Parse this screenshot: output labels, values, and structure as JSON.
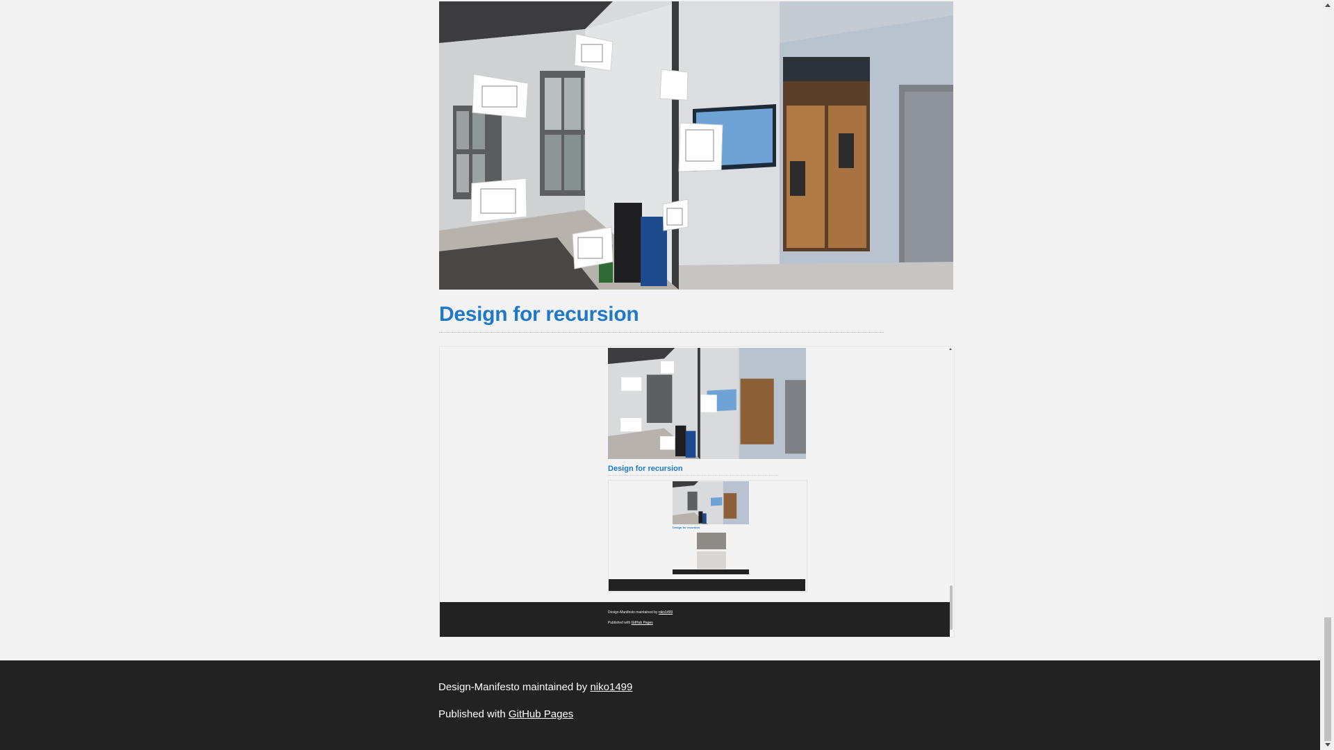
{
  "main": {
    "hero_image_alt": "panorama-hallway-with-floating-floorplans",
    "section_title": "Design for recursion",
    "embed": {
      "section_title": "Design for recursion",
      "nested_section_title": "Design for recursion",
      "footer": {
        "maintained_prefix": "Design-Manifesto maintained by ",
        "maintainer": "niko1499",
        "published_prefix": "Published with ",
        "published_link": "GitHub Pages"
      }
    }
  },
  "footer": {
    "maintained_prefix": "Design-Manifesto maintained by ",
    "maintainer": "niko1499",
    "published_prefix": "Published with ",
    "published_link": "GitHub Pages"
  },
  "colors": {
    "accent": "#1f78c8",
    "footer_bg": "#222222",
    "page_bg": "#f2f2f2"
  }
}
